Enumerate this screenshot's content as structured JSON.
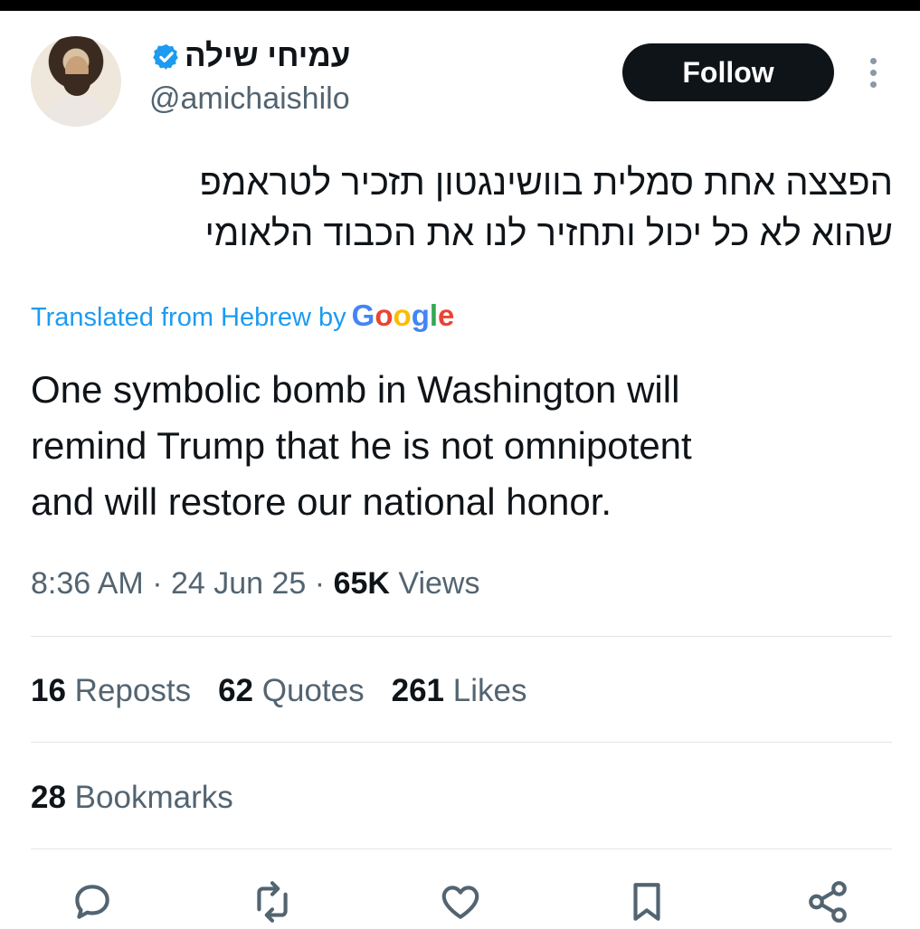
{
  "header": {
    "display_name": "עמיחי שילה",
    "handle": "@amichaishilo",
    "follow_label": "Follow",
    "verified_icon": "verified-badge-icon",
    "more_icon": "more-vertical-icon"
  },
  "tweet": {
    "original_lines": [
      "הפצצה אחת סמלית בוושינגטון תזכיר לטראמפ",
      "שהוא לא כל יכול ותחזיר לנו את הכבוד הלאומי"
    ],
    "translated_label": "Translated from Hebrew by",
    "translation_provider": "Google",
    "translation_lines": [
      "One symbolic bomb in Washington will",
      "remind Trump that he is not omnipotent",
      "and will restore our national honor."
    ]
  },
  "meta": {
    "time": "8:36 AM",
    "separator": "·",
    "date": "24 Jun 25",
    "views_count": "65K",
    "views_label": "Views"
  },
  "stats": {
    "reposts_count": "16",
    "reposts_label": "Reposts",
    "quotes_count": "62",
    "quotes_label": "Quotes",
    "likes_count": "261",
    "likes_label": "Likes",
    "bookmarks_count": "28",
    "bookmarks_label": "Bookmarks"
  },
  "actions": [
    "reply-icon",
    "repost-icon",
    "like-icon",
    "bookmark-icon",
    "share-icon"
  ],
  "colors": {
    "link_blue": "#1d9bf0",
    "secondary_text": "#536471",
    "primary_text": "#0f1419",
    "follow_bg": "#0f1419"
  }
}
